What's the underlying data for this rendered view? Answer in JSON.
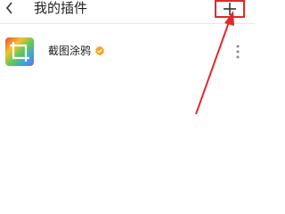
{
  "header": {
    "title": "我的插件",
    "back_icon": "chevron-left-icon",
    "add_icon": "plus-icon"
  },
  "plugins": [
    {
      "name": "截图涂鸦",
      "logo_icon": "crop-rainbow-icon",
      "badge_icon": "verified-badge-icon",
      "menu_icon": "more-vertical-icon"
    }
  ],
  "annotation": {
    "highlight_color": "#e02a2a",
    "arrow_color": "#e02a2a"
  },
  "colors": {
    "text": "#222222",
    "divider": "#e6e6e6",
    "badge": "#f5a623"
  }
}
